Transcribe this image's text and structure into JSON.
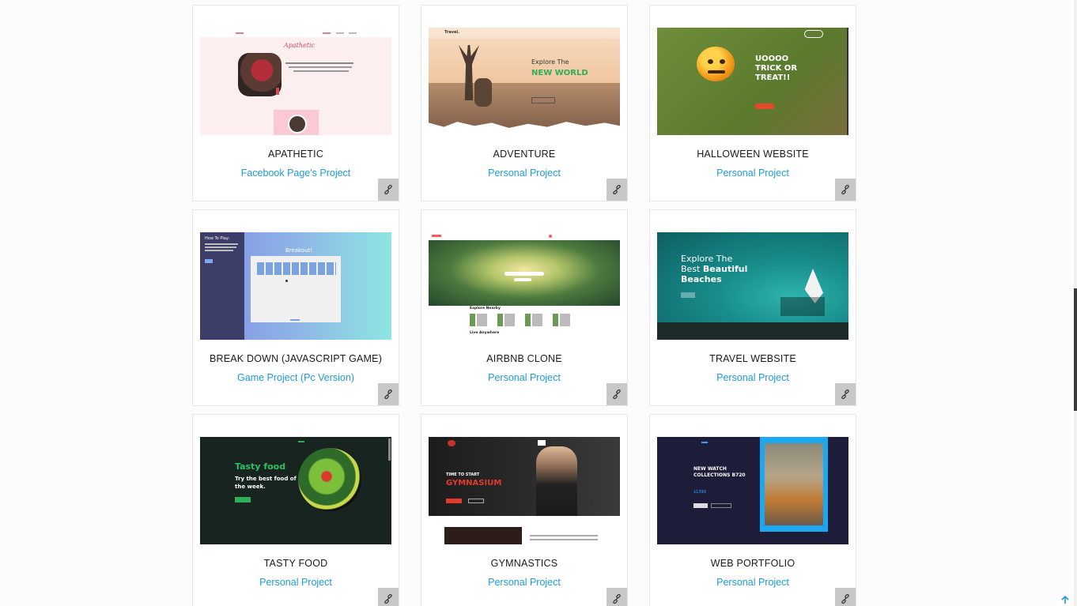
{
  "projects": [
    {
      "title": "APATHETIC",
      "subtitle": "Facebook Page's Project",
      "thumb": {
        "heading": "Apathetic"
      }
    },
    {
      "title": "ADVENTURE",
      "subtitle": "Personal Project",
      "thumb": {
        "brand": "Travel.",
        "line1": "Explore The",
        "line2": "NEW WORLD"
      }
    },
    {
      "title": "HALLOWEEN WEBSITE",
      "subtitle": "Personal Project",
      "thumb": {
        "line1": "UOOOO",
        "line2": "TRICK OR",
        "line3": "TREAT!!"
      }
    },
    {
      "title": "BREAK DOWN (JAVASCRIPT GAME)",
      "subtitle": "Game Project (Pc Version)",
      "thumb": {
        "side_title": "How To Play:",
        "game_title": "Breakout!"
      }
    },
    {
      "title": "AIRBNB CLONE",
      "subtitle": "Personal Project",
      "thumb": {
        "section1": "Explore Nearby",
        "section2": "Live Anywhere"
      }
    },
    {
      "title": "TRAVEL WEBSITE",
      "subtitle": "Personal Project",
      "thumb": {
        "line1": "Explore The",
        "line2a": "Best ",
        "line2b": "Beautiful",
        "line3": "Beaches"
      }
    },
    {
      "title": "TASTY FOOD",
      "subtitle": "Personal Project",
      "thumb": {
        "heading": "Tasty food",
        "line1": "Try the best food of",
        "line2": "the week."
      }
    },
    {
      "title": "GYMNASTICS",
      "subtitle": "Personal Project",
      "thumb": {
        "line1": "TIME TO START",
        "line2": "GYMNASIUM"
      }
    },
    {
      "title": "WEB PORTFOLIO",
      "subtitle": "Personal Project",
      "thumb": {
        "line1": "NEW WATCH",
        "line2": "COLLECTIONS B720",
        "price": "$1399"
      }
    }
  ],
  "colors": {
    "subtitle": "#1e9ad6",
    "link_button": "#c8c8c8"
  },
  "icons": {
    "card_link": "link-icon",
    "back_to_top": "arrow-up-icon"
  }
}
